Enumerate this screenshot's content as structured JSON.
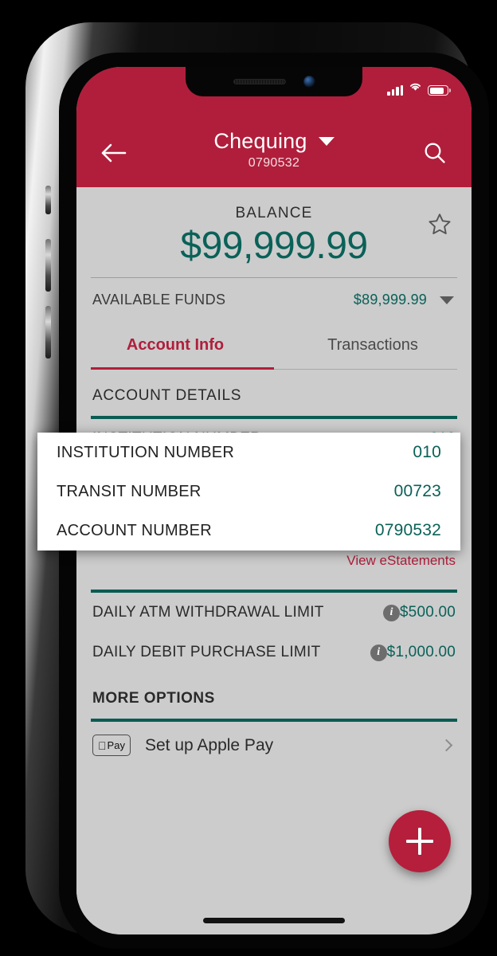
{
  "status_bar": {
    "signal_icon": "signal-bars-icon",
    "wifi_icon": "wifi-icon",
    "battery_icon": "battery-icon"
  },
  "header": {
    "back_icon": "back-arrow-icon",
    "title": "Chequing",
    "subtitle": "0790532",
    "dropdown_icon": "chevron-down-icon",
    "search_icon": "search-icon",
    "background_color": "#b01e3b"
  },
  "balance": {
    "label": "BALANCE",
    "amount": "$99,999.99",
    "amount_color": "#0a6158",
    "favorite_icon": "star-outline-icon",
    "available_label": "AVAILABLE FUNDS",
    "available_amount": "$89,999.99",
    "available_dropdown_icon": "chevron-down-icon"
  },
  "tabs": [
    {
      "label": "Account Info",
      "active": true
    },
    {
      "label": "Transactions",
      "active": false
    }
  ],
  "account_details": {
    "section_title": "ACCOUNT DETAILS",
    "rows": [
      {
        "label": "INSTITUTION NUMBER",
        "value": "010"
      },
      {
        "label": "TRANSIT NUMBER",
        "value": "00723"
      },
      {
        "label": "ACCOUNT NUMBER",
        "value": "0790532"
      }
    ],
    "estatements_link": "View eStatements"
  },
  "limits": [
    {
      "label": "DAILY ATM WITHDRAWAL LIMIT",
      "info_icon": "info-icon",
      "value": "$500.00"
    },
    {
      "label": "DAILY DEBIT PURCHASE LIMIT",
      "info_icon": "info-icon",
      "value": "$1,000.00"
    }
  ],
  "more_options": {
    "section_title": "MORE OPTIONS",
    "items": [
      {
        "badge_icon": "apple-pay-badge-icon",
        "badge_apple_glyph": "",
        "badge_pay_text": "Pay",
        "label": "Set up Apple Pay",
        "chevron_icon": "chevron-right-icon"
      }
    ]
  },
  "fab": {
    "icon": "plus-icon",
    "color": "#b51f3c"
  },
  "colors": {
    "brand_crimson": "#b01e3b",
    "accent_teal": "#0a5c52",
    "value_teal": "#0a6158",
    "screen_background": "#cccccc"
  }
}
